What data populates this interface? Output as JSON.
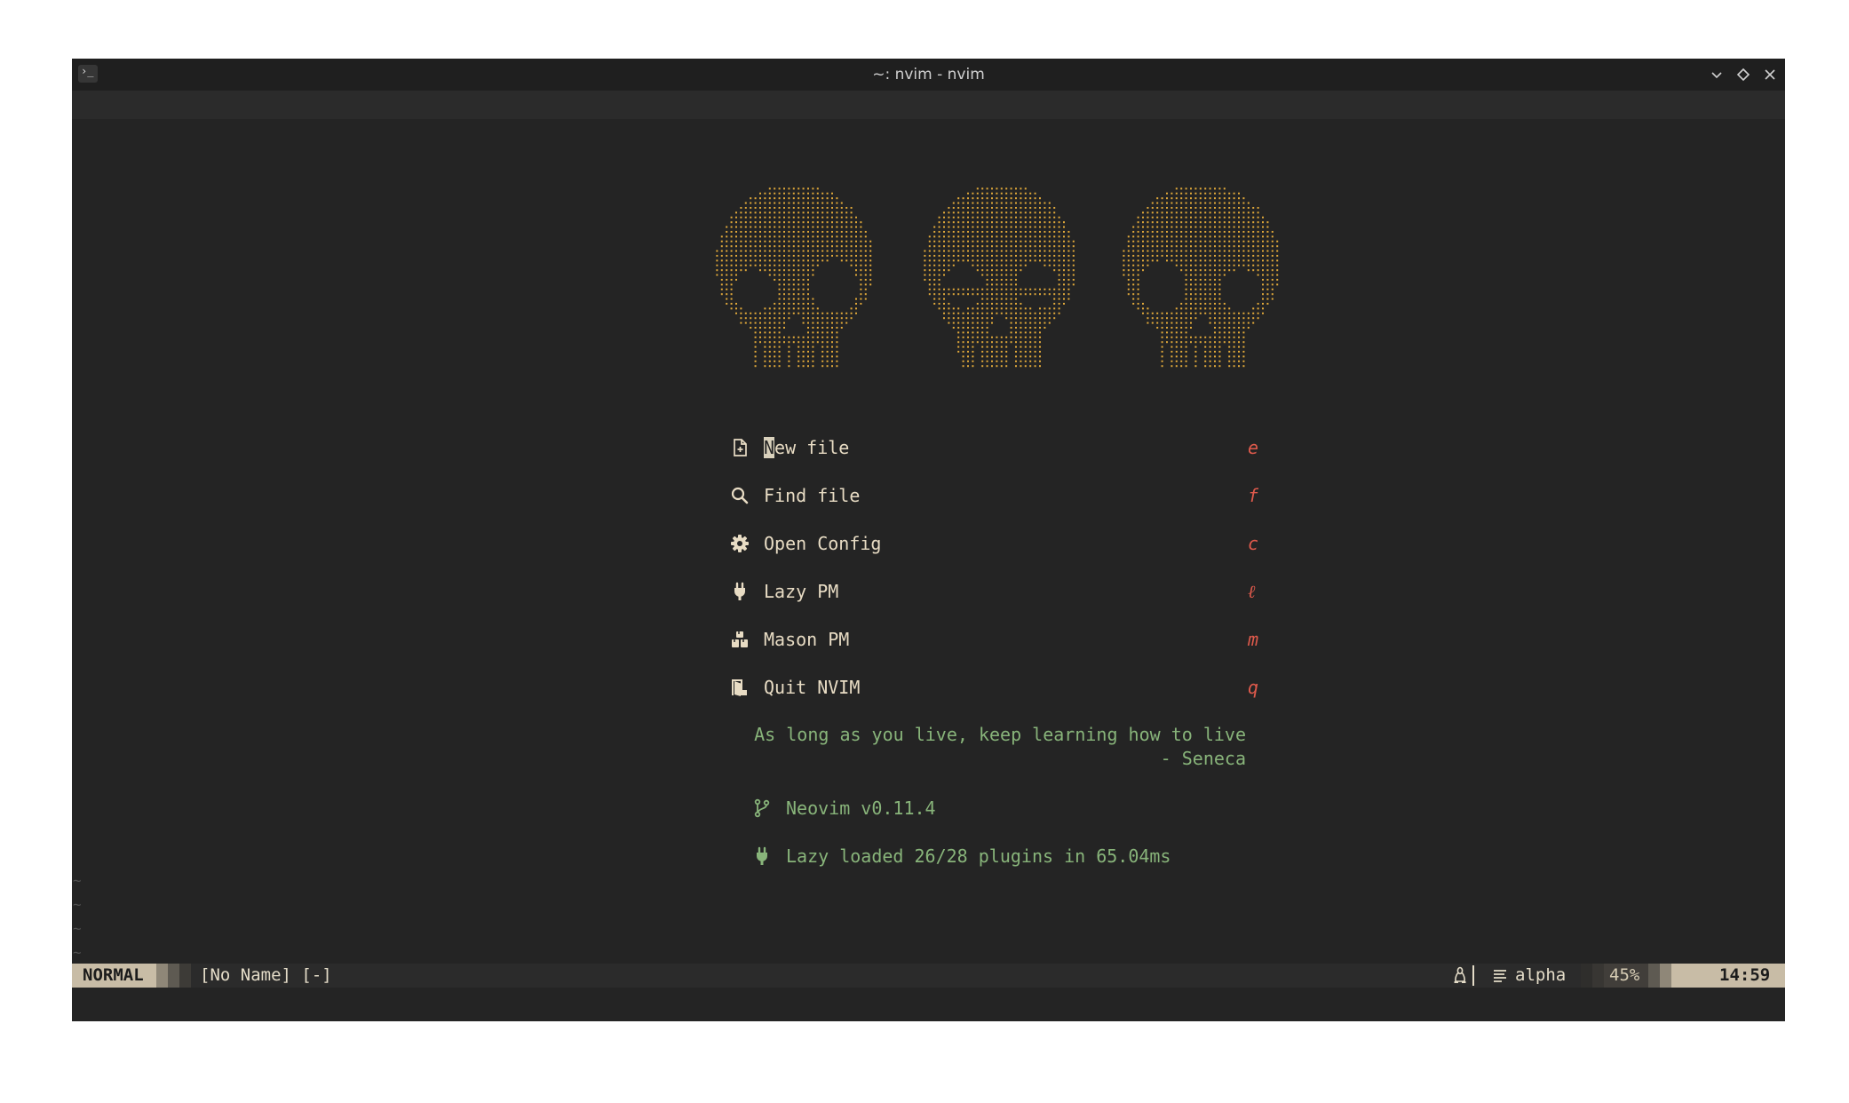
{
  "window": {
    "title": "~: nvim - nvim",
    "terminal_icon": "terminal-icon",
    "controls": [
      "minimize-icon",
      "maximize-icon",
      "close-icon"
    ]
  },
  "dashboard": {
    "header_art": "three-skulls-ascii",
    "menu": [
      {
        "icon": "new-file-icon",
        "label": "New file",
        "key": "e"
      },
      {
        "icon": "search-icon",
        "label": "Find file",
        "key": "f"
      },
      {
        "icon": "gear-icon",
        "label": "Open Config",
        "key": "c"
      },
      {
        "icon": "plug-icon",
        "label": "Lazy PM",
        "key": "ℓ"
      },
      {
        "icon": "packages-icon",
        "label": "Mason PM",
        "key": "m"
      },
      {
        "icon": "exit-icon",
        "label": "Quit NVIM",
        "key": "q"
      }
    ],
    "quote": {
      "text": "As long as you live, keep learning how to live",
      "author": "- Seneca"
    },
    "version": {
      "icon": "git-branch-icon",
      "text": "Neovim v0.11.4"
    },
    "lazy_stats": {
      "icon": "plug-icon",
      "text": "Lazy loaded 26/28 plugins in 65.04ms"
    }
  },
  "tildes": [
    "~",
    "~",
    "~",
    "~"
  ],
  "statusline": {
    "mode": "NORMAL",
    "filename": "[No Name] [-]",
    "os_icon": "linux-icon",
    "filetype_icon": "lines-icon",
    "filetype": "alpha",
    "progress": "45%",
    "time": "14:59"
  },
  "colors": {
    "background": "#242424",
    "art": "#e0a83a",
    "text": "#e8dcc4",
    "key": "#e05a4c",
    "green": "#88b47a",
    "mode_bg": "#c8bca6"
  }
}
